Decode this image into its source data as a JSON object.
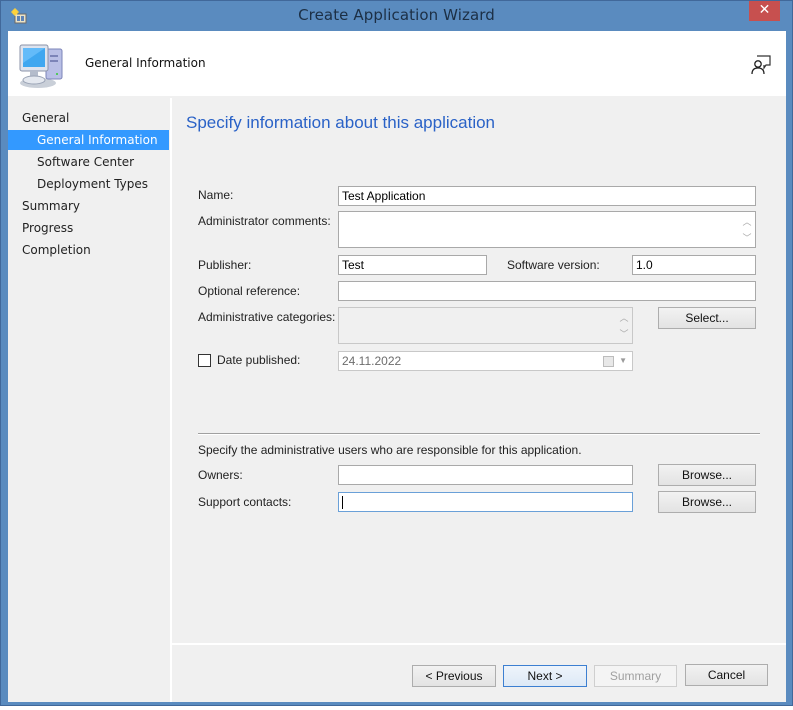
{
  "window": {
    "title": "Create Application Wizard",
    "close_glyph": "✕"
  },
  "header": {
    "title": "General Information",
    "icons": {
      "left": "computer-icon",
      "right": "feedback-icon"
    }
  },
  "sidebar": {
    "items": [
      {
        "label": "General",
        "level": 0,
        "active": false
      },
      {
        "label": "General Information",
        "level": 1,
        "active": true
      },
      {
        "label": "Software Center",
        "level": 1,
        "active": false
      },
      {
        "label": "Deployment Types",
        "level": 1,
        "active": false
      },
      {
        "label": "Summary",
        "level": 0,
        "active": false
      },
      {
        "label": "Progress",
        "level": 0,
        "active": false
      },
      {
        "label": "Completion",
        "level": 0,
        "active": false
      }
    ]
  },
  "main": {
    "heading": "Specify information about this application",
    "fields": {
      "name": {
        "label": "Name:",
        "value": "Test Application"
      },
      "admin_comments": {
        "label": "Administrator comments:",
        "value": ""
      },
      "publisher": {
        "label": "Publisher:",
        "value": "Test"
      },
      "software_version": {
        "label": "Software version:",
        "value": "1.0"
      },
      "optional_reference": {
        "label": "Optional reference:",
        "value": ""
      },
      "admin_categories": {
        "label": "Administrative categories:",
        "value": "",
        "button": "Select..."
      },
      "date_published": {
        "label": "Date published:",
        "value": "24.11.2022",
        "checked": false
      }
    },
    "users_section": {
      "description": "Specify the administrative users who are responsible for this application.",
      "owners": {
        "label": "Owners:",
        "value": "",
        "button": "Browse..."
      },
      "support_contacts": {
        "label": "Support contacts:",
        "value": "",
        "button": "Browse..."
      }
    }
  },
  "footer": {
    "previous": "< Previous",
    "next": "Next >",
    "summary": "Summary",
    "cancel": "Cancel"
  },
  "colors": {
    "titlebar": "#5a8bbf",
    "close": "#c7504f",
    "selection": "#3399ff",
    "heading": "#2a62c7"
  }
}
